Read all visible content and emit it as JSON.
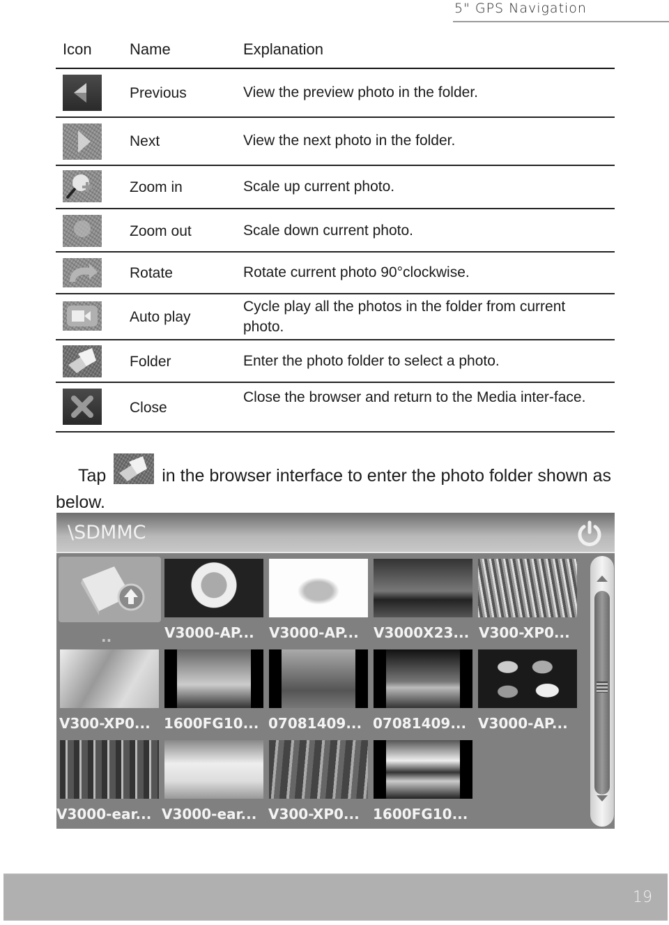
{
  "header": {
    "title": "5\" GPS Navigation"
  },
  "table": {
    "columns": [
      "Icon",
      "Name",
      "Explanation"
    ],
    "rows": [
      {
        "icon": "previous-icon",
        "name": "Previous",
        "explanation": "View the preview photo in the folder."
      },
      {
        "icon": "next-icon",
        "name": "Next",
        "explanation": "View the next photo in the folder."
      },
      {
        "icon": "zoom-in-icon",
        "name": "Zoom in",
        "explanation": "Scale up current photo."
      },
      {
        "icon": "zoom-out-icon",
        "name": "Zoom out",
        "explanation": "Scale down current photo."
      },
      {
        "icon": "rotate-icon",
        "name": "Rotate",
        "explanation": "Rotate current photo 90°clockwise."
      },
      {
        "icon": "auto-play-icon",
        "name": "Auto play",
        "explanation": "Cycle play all the photos in the folder from current photo."
      },
      {
        "icon": "folder-icon",
        "name": "Folder",
        "explanation": "Enter the photo folder to select a photo."
      },
      {
        "icon": "close-icon",
        "name": "Close",
        "explanation": "Close the browser and return to the Media inter-face."
      }
    ]
  },
  "instruction": {
    "before_icon": "Tap",
    "icon": "folder-icon",
    "after_icon": "in the browser interface to enter the photo folder shown as below."
  },
  "browser": {
    "path": "\\SDMMC",
    "power_icon": "power-icon",
    "parent_label": "..",
    "files": [
      "V3000-AP...",
      "V3000-AP...",
      "V3000X23...",
      "V300-XP0...",
      "V300-XP0...",
      "1600FG10...",
      "07081409...",
      "07081409...",
      "V3000-AP...",
      "V3000-ear...",
      "V3000-ear...",
      "V300-XP0...",
      "1600FG10..."
    ],
    "scrollbar": {
      "up_icon": "scroll-up-icon",
      "down_icon": "scroll-down-icon"
    }
  },
  "footer": {
    "page_number": "19"
  }
}
